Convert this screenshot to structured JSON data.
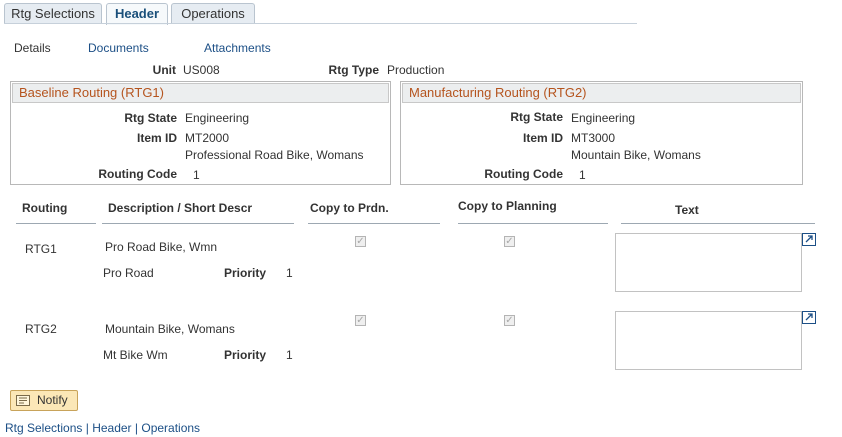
{
  "tabs": [
    {
      "label": "Rtg Selections",
      "active": false
    },
    {
      "label": "Header",
      "active": true
    },
    {
      "label": "Operations",
      "active": false
    }
  ],
  "subnav": {
    "details": "Details",
    "documents": "Documents",
    "attachments": "Attachments"
  },
  "header": {
    "unit_label": "Unit",
    "unit_value": "US008",
    "rtg_type_label": "Rtg Type",
    "rtg_type_value": "Production"
  },
  "baseline": {
    "title": "Baseline Routing (RTG1)",
    "rtg_state_label": "Rtg State",
    "rtg_state_value": "Engineering",
    "item_id_label": "Item ID",
    "item_id_value": "MT2000",
    "item_desc": "Professional Road Bike, Womans",
    "routing_code_label": "Routing Code",
    "routing_code_value": "1"
  },
  "manufacturing": {
    "title": "Manufacturing Routing (RTG2)",
    "rtg_state_label": "Rtg State",
    "rtg_state_value": "Engineering",
    "item_id_label": "Item ID",
    "item_id_value": "MT3000",
    "item_desc": "Mountain Bike, Womans",
    "routing_code_label": "Routing Code",
    "routing_code_value": "1"
  },
  "grid": {
    "columns": {
      "routing": "Routing",
      "description": "Description / Short Descr",
      "copy_prdn": "Copy to Prdn.",
      "copy_planning": "Copy to Planning",
      "text": "Text"
    },
    "rows": [
      {
        "routing": "RTG1",
        "description": "Pro Road Bike, Wmn",
        "short_descr": "Pro Road",
        "priority_label": "Priority",
        "priority": "1",
        "copy_prdn": true,
        "copy_planning": true
      },
      {
        "routing": "RTG2",
        "description": "Mountain Bike, Womans",
        "short_descr": "Mt Bike Wm",
        "priority_label": "Priority",
        "priority": "1",
        "copy_prdn": true,
        "copy_planning": true
      }
    ]
  },
  "notify_button": {
    "label": "Notify"
  },
  "footer": {
    "rtg_selections": "Rtg Selections",
    "separator": "|",
    "header": "Header",
    "operations": "Operations"
  },
  "colors": {
    "group_title": "#b5541e",
    "link": "#1c4f86",
    "button_bg": "#fbe7b7"
  },
  "icons": {
    "expand": "expand-textarea-icon",
    "notify": "notify-icon",
    "check": "checkmark"
  }
}
